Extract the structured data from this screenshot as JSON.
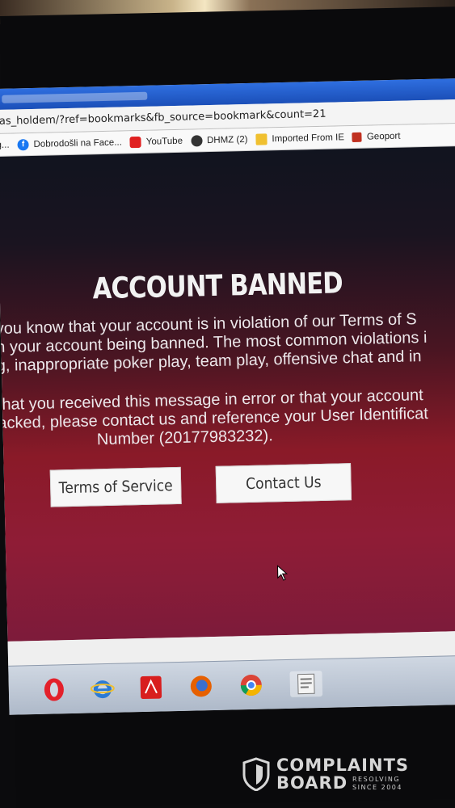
{
  "browser": {
    "url": "as_holdem/?ref=bookmarks&fb_source=bookmark&count=21",
    "bookmarks": [
      {
        "label": "g...",
        "icon": "none"
      },
      {
        "label": "Dobrodošli na Face...",
        "icon": "facebook-icon"
      },
      {
        "label": "YouTube",
        "icon": "youtube-icon"
      },
      {
        "label": "DHMZ (2)",
        "icon": "dhmz-icon"
      },
      {
        "label": "Imported From IE",
        "icon": "folder-icon"
      },
      {
        "label": "Geoport",
        "icon": "geoportal-icon"
      }
    ]
  },
  "page": {
    "title": "ACCOUNT BANNED",
    "paragraph1": [
      " you know that your account is in violation of our Terms of S",
      "n your account being banned. The most common violations i",
      "g, inappropriate poker play, team play, offensive chat and in"
    ],
    "paragraph2": [
      " that you received this message in error or that your account",
      "acked, please contact us and reference your User Identificat",
      "Number (20177983232)."
    ],
    "buttons": {
      "terms": "Terms of Service",
      "contact": "Contact Us"
    }
  },
  "taskbar": {
    "apps": [
      "opera-icon",
      "internet-explorer-icon",
      "acrobat-icon",
      "firefox-icon",
      "chrome-icon",
      "word-icon"
    ]
  },
  "watermark": {
    "line1": "COMPLAINTS",
    "line2": "BOARD",
    "tagline1": "RESOLVING",
    "tagline2": "SINCE 2004"
  },
  "colors": {
    "background_top": "#11141f",
    "background_bottom": "#8f1c36",
    "button_bg": "#f7f7f7",
    "titlebar": "#2f6fe0"
  }
}
